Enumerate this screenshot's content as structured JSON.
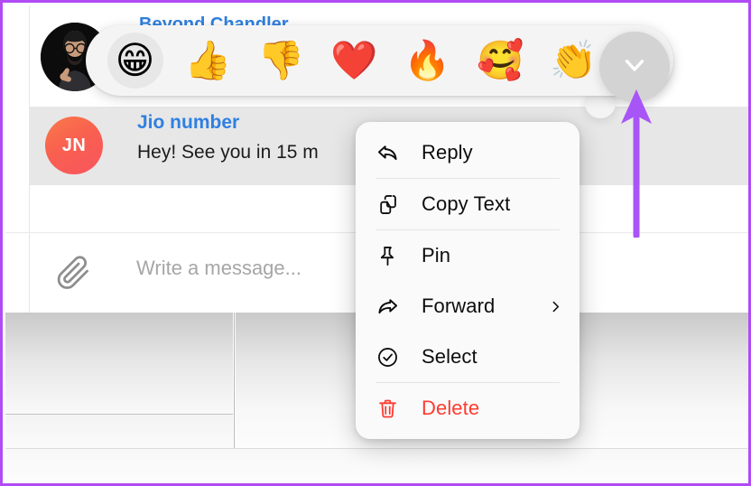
{
  "annotation": {
    "arrow_color": "#a855f7",
    "frame_color": "#b14bf4",
    "arrow_name": "highlight-arrow-to-expand-button"
  },
  "chat": {
    "ghost_contact_name": "Beyond Chandler",
    "selected_message": {
      "avatar_initials": "JN",
      "avatar_color": "#f8604f",
      "sender": "Jio number",
      "sender_color": "#2f80e0",
      "text": "Hey! See you in 15 m"
    },
    "composer": {
      "attach_icon": "paperclip-icon",
      "placeholder": "Write a message..."
    }
  },
  "reaction_bar": {
    "reactions": [
      {
        "name": "grinning-face-emoji",
        "glyph": "😁",
        "selected": true
      },
      {
        "name": "thumbs-up-emoji",
        "glyph": "👍",
        "selected": false
      },
      {
        "name": "thumbs-down-emoji",
        "glyph": "👎",
        "selected": false
      },
      {
        "name": "red-heart-emoji",
        "glyph": "❤️",
        "selected": false
      },
      {
        "name": "fire-emoji",
        "glyph": "🔥",
        "selected": false
      },
      {
        "name": "smiling-face-with-hearts-emoji",
        "glyph": "🥰",
        "selected": false
      },
      {
        "name": "clapping-hands-emoji",
        "glyph": "👏",
        "selected": false
      }
    ],
    "expand_button": {
      "name": "expand-reactions-button",
      "icon": "chevron-down-icon",
      "color": "#d3d3d3"
    }
  },
  "context_menu": {
    "items": [
      {
        "label": "Reply",
        "icon": "reply-arrow-icon",
        "danger": false,
        "submenu": false,
        "separator_after": true
      },
      {
        "label": "Copy Text",
        "icon": "copy-documents-icon",
        "danger": false,
        "submenu": false,
        "separator_after": true
      },
      {
        "label": "Pin",
        "icon": "pushpin-icon",
        "danger": false,
        "submenu": false,
        "separator_after": false
      },
      {
        "label": "Forward",
        "icon": "forward-arrow-icon",
        "danger": false,
        "submenu": true,
        "separator_after": false
      },
      {
        "label": "Select",
        "icon": "check-circle-icon",
        "danger": false,
        "submenu": false,
        "separator_after": true
      },
      {
        "label": "Delete",
        "icon": "trash-icon",
        "danger": true,
        "submenu": false,
        "separator_after": false
      }
    ],
    "danger_color": "#ff3b30"
  }
}
